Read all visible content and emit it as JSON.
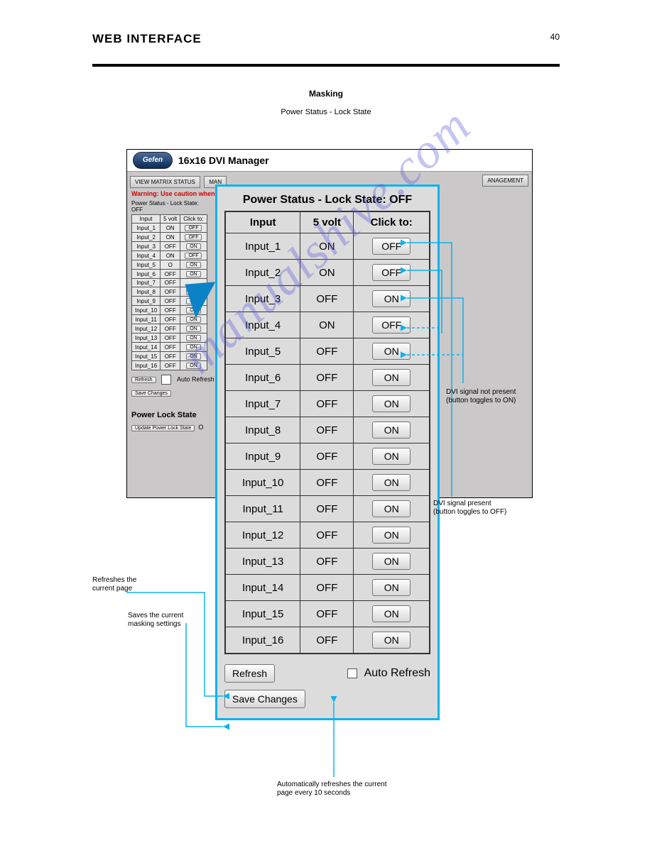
{
  "page_header": "WEB INTERFACE",
  "page_number": "40",
  "section_title": "Masking",
  "section_sub": "Power Status - Lock State",
  "app": {
    "brand": "Gefen",
    "title": "16x16 DVI Manager",
    "tabs": {
      "view": "VIEW MATRIX STATUS",
      "manage": "MAN",
      "mgmt": "ANAGEMENT"
    },
    "warning": "Warning: Use caution when a",
    "mini_caption": "Power Status - Lock State: OFF",
    "mini_headers": {
      "a": "Input",
      "b": "5 volt",
      "c": "Click to:"
    },
    "mini_rows": [
      {
        "i": "Input_1",
        "v": "ON",
        "b": "OFF"
      },
      {
        "i": "Input_2",
        "v": "ON",
        "b": "OFF"
      },
      {
        "i": "Input_3",
        "v": "OFF",
        "b": "ON"
      },
      {
        "i": "Input_4",
        "v": "ON",
        "b": "OFF"
      },
      {
        "i": "Input_5",
        "v": "O",
        "b": "ON"
      },
      {
        "i": "Input_6",
        "v": "OFF",
        "b": "ON"
      },
      {
        "i": "Input_7",
        "v": "OFF",
        "b": ""
      },
      {
        "i": "Input_8",
        "v": "OFF",
        "b": "ON"
      },
      {
        "i": "Input_9",
        "v": "OFF",
        "b": "ON"
      },
      {
        "i": "Input_10",
        "v": "OFF",
        "b": "ON"
      },
      {
        "i": "Input_11",
        "v": "OFF",
        "b": "ON"
      },
      {
        "i": "Input_12",
        "v": "OFF",
        "b": "ON"
      },
      {
        "i": "Input_13",
        "v": "OFF",
        "b": "ON"
      },
      {
        "i": "Input_14",
        "v": "OFF",
        "b": "ON"
      },
      {
        "i": "Input_15",
        "v": "OFF",
        "b": "ON"
      },
      {
        "i": "Input_16",
        "v": "OFF",
        "b": "ON"
      }
    ],
    "refresh": "Refresh",
    "auto_refresh": "Auto Refresh",
    "save": "Save Changes",
    "lock_title": "Power Lock State",
    "lock_btn": "Update Power Lock State",
    "lock_radio": "O"
  },
  "callout": {
    "title": "Power Status - Lock State:  OFF",
    "headers": {
      "a": "Input",
      "b": "5 volt",
      "c": "Click to:"
    },
    "rows": [
      {
        "i": "Input_1",
        "v": "ON",
        "b": "OFF"
      },
      {
        "i": "Input_2",
        "v": "ON",
        "b": "OFF"
      },
      {
        "i": "Input_3",
        "v": "OFF",
        "b": "ON"
      },
      {
        "i": "Input_4",
        "v": "ON",
        "b": "OFF"
      },
      {
        "i": "Input_5",
        "v": "OFF",
        "b": "ON"
      },
      {
        "i": "Input_6",
        "v": "OFF",
        "b": "ON"
      },
      {
        "i": "Input_7",
        "v": "OFF",
        "b": "ON"
      },
      {
        "i": "Input_8",
        "v": "OFF",
        "b": "ON"
      },
      {
        "i": "Input_9",
        "v": "OFF",
        "b": "ON"
      },
      {
        "i": "Input_10",
        "v": "OFF",
        "b": "ON"
      },
      {
        "i": "Input_11",
        "v": "OFF",
        "b": "ON"
      },
      {
        "i": "Input_12",
        "v": "OFF",
        "b": "ON"
      },
      {
        "i": "Input_13",
        "v": "OFF",
        "b": "ON"
      },
      {
        "i": "Input_14",
        "v": "OFF",
        "b": "ON"
      },
      {
        "i": "Input_15",
        "v": "OFF",
        "b": "ON"
      },
      {
        "i": "Input_16",
        "v": "OFF",
        "b": "ON"
      }
    ],
    "refresh": "Refresh",
    "auto_refresh": "Auto Refresh",
    "save": "Save Changes"
  },
  "annotations": {
    "dvi_on": "DVI signal present\n(button toggles to OFF)",
    "dvi_off": "DVI signal not present\n(button toggles to ON)",
    "refreshes": "Refreshes the\ncurrent page",
    "saves": "Saves the current\nmasking settings",
    "auto_note": "Automatically refreshes the current\npage every 10 seconds"
  },
  "watermark": "manualshive.com"
}
